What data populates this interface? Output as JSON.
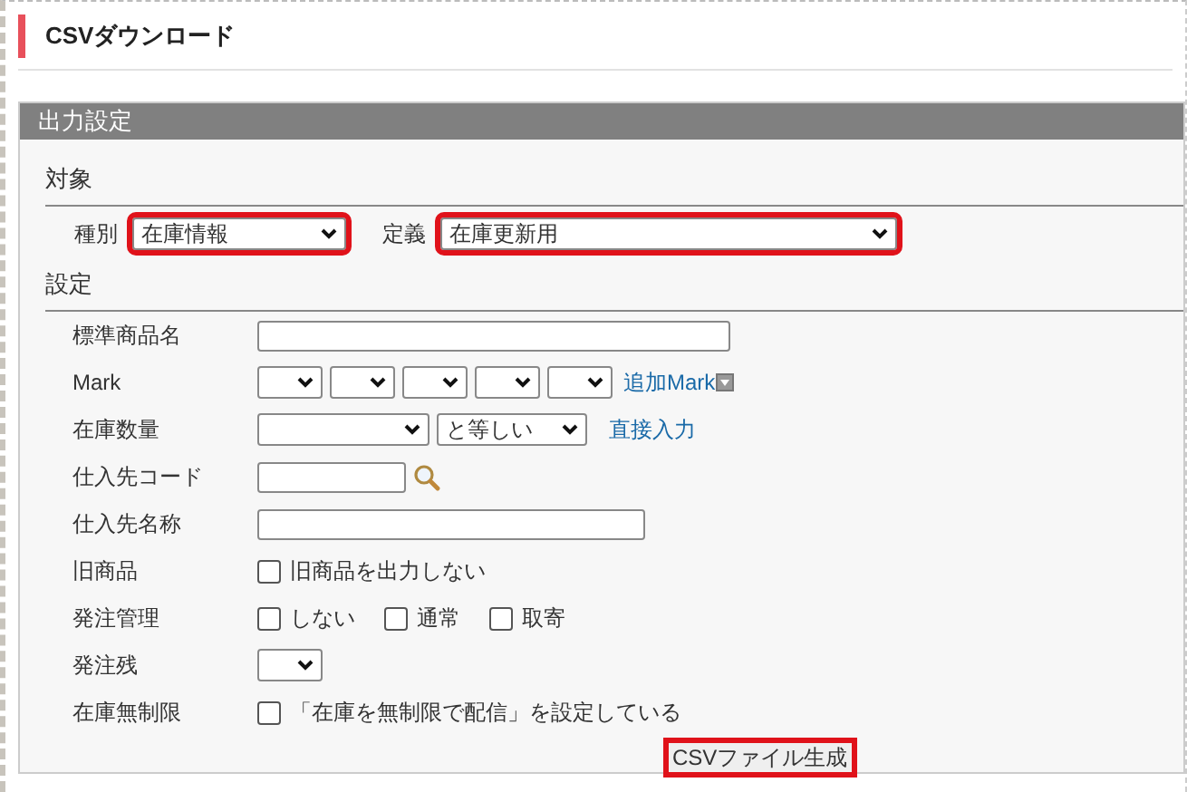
{
  "page_title": "CSVダウンロード",
  "panel": {
    "title": "出力設定",
    "target": {
      "heading": "対象",
      "fields": [
        {
          "label": "種別",
          "value": "在庫情報",
          "highlighted": true
        },
        {
          "label": "定義",
          "value": "在庫更新用",
          "highlighted": true
        }
      ]
    },
    "settings": {
      "heading": "設定",
      "rows": [
        {
          "kind": "text",
          "label": "標準商品名"
        },
        {
          "kind": "marks",
          "label": "Mark",
          "link": "追加Mark"
        },
        {
          "kind": "quantity",
          "label": "在庫数量",
          "operator": "と等しい",
          "link": "直接入力"
        },
        {
          "kind": "code",
          "label": "仕入先コード"
        },
        {
          "kind": "text",
          "label": "仕入先名称"
        },
        {
          "kind": "checks",
          "label": "旧商品",
          "options": [
            {
              "label": "旧商品を出力しない",
              "checked": false
            }
          ]
        },
        {
          "kind": "checks",
          "label": "発注管理",
          "options": [
            {
              "label": "しない",
              "checked": false
            },
            {
              "label": "通常",
              "checked": false
            },
            {
              "label": "取寄",
              "checked": false
            }
          ]
        },
        {
          "kind": "select",
          "label": "発注残"
        },
        {
          "kind": "checks",
          "label": "在庫無制限",
          "options": [
            {
              "label": "「在庫を無制限で配信」を設定している",
              "checked": false
            }
          ]
        }
      ]
    },
    "submit": {
      "label": "CSVファイル生成",
      "highlighted": true
    }
  }
}
